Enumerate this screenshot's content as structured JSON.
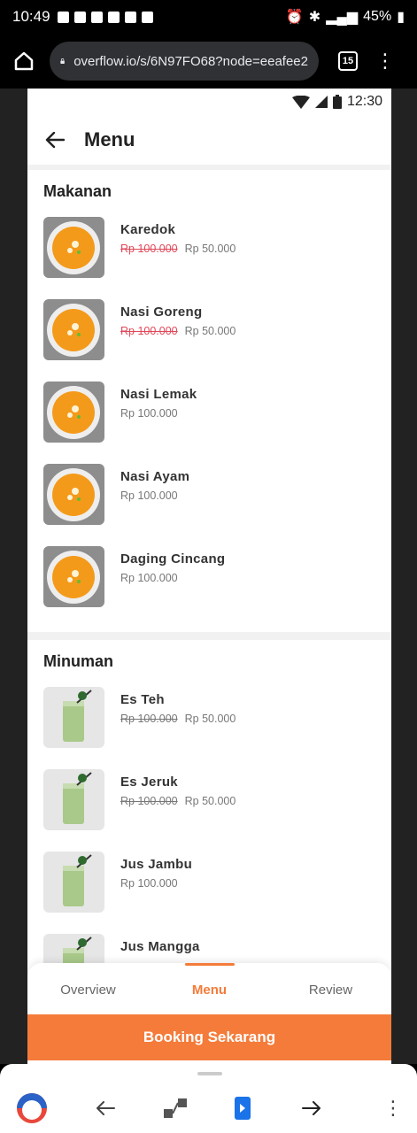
{
  "status_bar": {
    "time": "10:49",
    "battery": "45%"
  },
  "browser": {
    "url": "overflow.io/s/6N97FO68?node=eeafee2",
    "tab_count": "15"
  },
  "phone": {
    "time": "12:30"
  },
  "header": {
    "title": "Menu"
  },
  "sections": [
    {
      "title": "Makanan",
      "items": [
        {
          "name": "Karedok",
          "old_price": "Rp 100.000",
          "price": "Rp 50.000",
          "type": "soup",
          "old_color": "red"
        },
        {
          "name": "Nasi Goreng",
          "old_price": "Rp 100.000",
          "price": "Rp 50.000",
          "type": "soup",
          "old_color": "red"
        },
        {
          "name": "Nasi Lemak",
          "old_price": "",
          "price": "Rp 100.000",
          "type": "soup"
        },
        {
          "name": "Nasi Ayam",
          "old_price": "",
          "price": "Rp 100.000",
          "type": "soup"
        },
        {
          "name": "Daging Cincang",
          "old_price": "",
          "price": "Rp 100.000",
          "type": "soup"
        }
      ]
    },
    {
      "title": "Minuman",
      "items": [
        {
          "name": "Es Teh",
          "old_price": "Rp 100.000",
          "price": "Rp 50.000",
          "type": "drink",
          "old_color": "gray"
        },
        {
          "name": "Es Jeruk",
          "old_price": "Rp 100.000",
          "price": "Rp 50.000",
          "type": "drink",
          "old_color": "gray"
        },
        {
          "name": "Jus Jambu",
          "old_price": "",
          "price": "Rp 100.000",
          "type": "drink"
        },
        {
          "name": "Jus Mangga",
          "old_price": "",
          "price": "",
          "type": "drink"
        }
      ]
    }
  ],
  "tabs": {
    "overview": "Overview",
    "menu": "Menu",
    "review": "Review"
  },
  "booking_button": "Booking Sekarang",
  "colors": {
    "accent": "#f47b3a",
    "strike_red": "#e0495a"
  },
  "icons": [
    "home-icon",
    "lock-icon",
    "back-arrow-icon",
    "wifi-icon",
    "signal-icon",
    "battery-icon",
    "forward-icon",
    "tab-switcher-icon",
    "more-icon"
  ]
}
